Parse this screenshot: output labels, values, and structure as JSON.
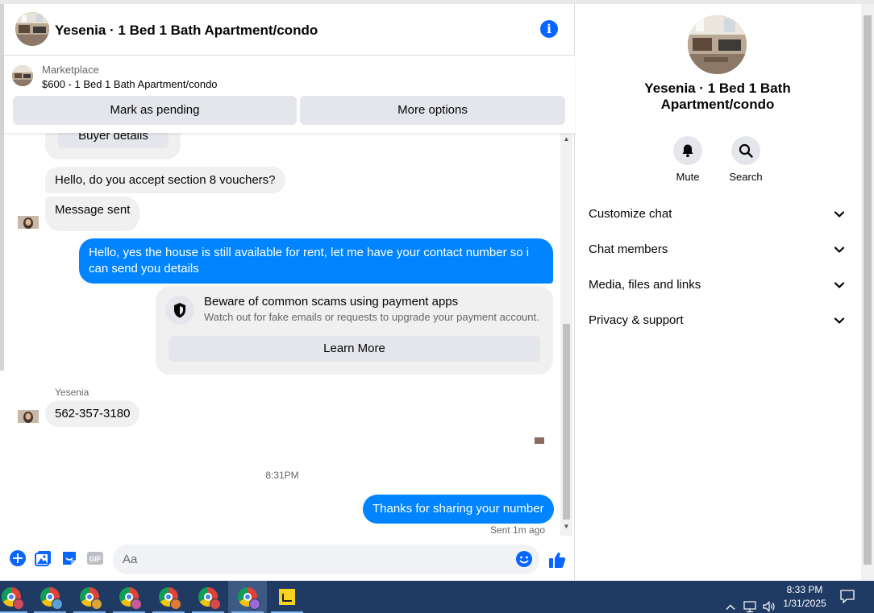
{
  "chat": {
    "title": "Yesenia · 1 Bed 1 Bath Apartment/condo",
    "marketplace_label": "Marketplace",
    "listing": "$600 - 1 Bed 1 Bath Apartment/condo",
    "mark_pending_label": "Mark as pending",
    "more_options_label": "More options",
    "buyer_details_label": "Buyer details"
  },
  "messages": {
    "incoming_1": "Hello, do you accept section 8 vouchers?",
    "incoming_2": "Message sent",
    "outgoing_1": "Hello, yes the house is still available for rent, let me have your contact number so i can send you  details",
    "scam_title": "Beware of common scams using payment apps",
    "scam_desc": "Watch out for fake emails or requests to upgrade your payment account.",
    "learn_more": "Learn More",
    "sender_name": "Yesenia",
    "incoming_3": "562-357-3180",
    "timestamp": "8:31PM",
    "outgoing_2": "Thanks for sharing your number",
    "sent_status": "Sent 1m ago"
  },
  "composer": {
    "placeholder": "Aa",
    "gif_label": "GIF"
  },
  "info_panel": {
    "title": "Yesenia · 1 Bed 1 Bath Apartment/condo",
    "mute_label": "Mute",
    "search_label": "Search",
    "sections": [
      "Customize chat",
      "Chat members",
      "Media, files and links",
      "Privacy & support"
    ]
  },
  "taskbar": {
    "time": "8:33 PM",
    "date": "1/31/2025"
  },
  "colors": {
    "accent": "#0866ff",
    "outgoing_bubble": "#0084ff",
    "incoming_bubble": "#f0f0f0",
    "taskbar": "#1f3a63"
  }
}
